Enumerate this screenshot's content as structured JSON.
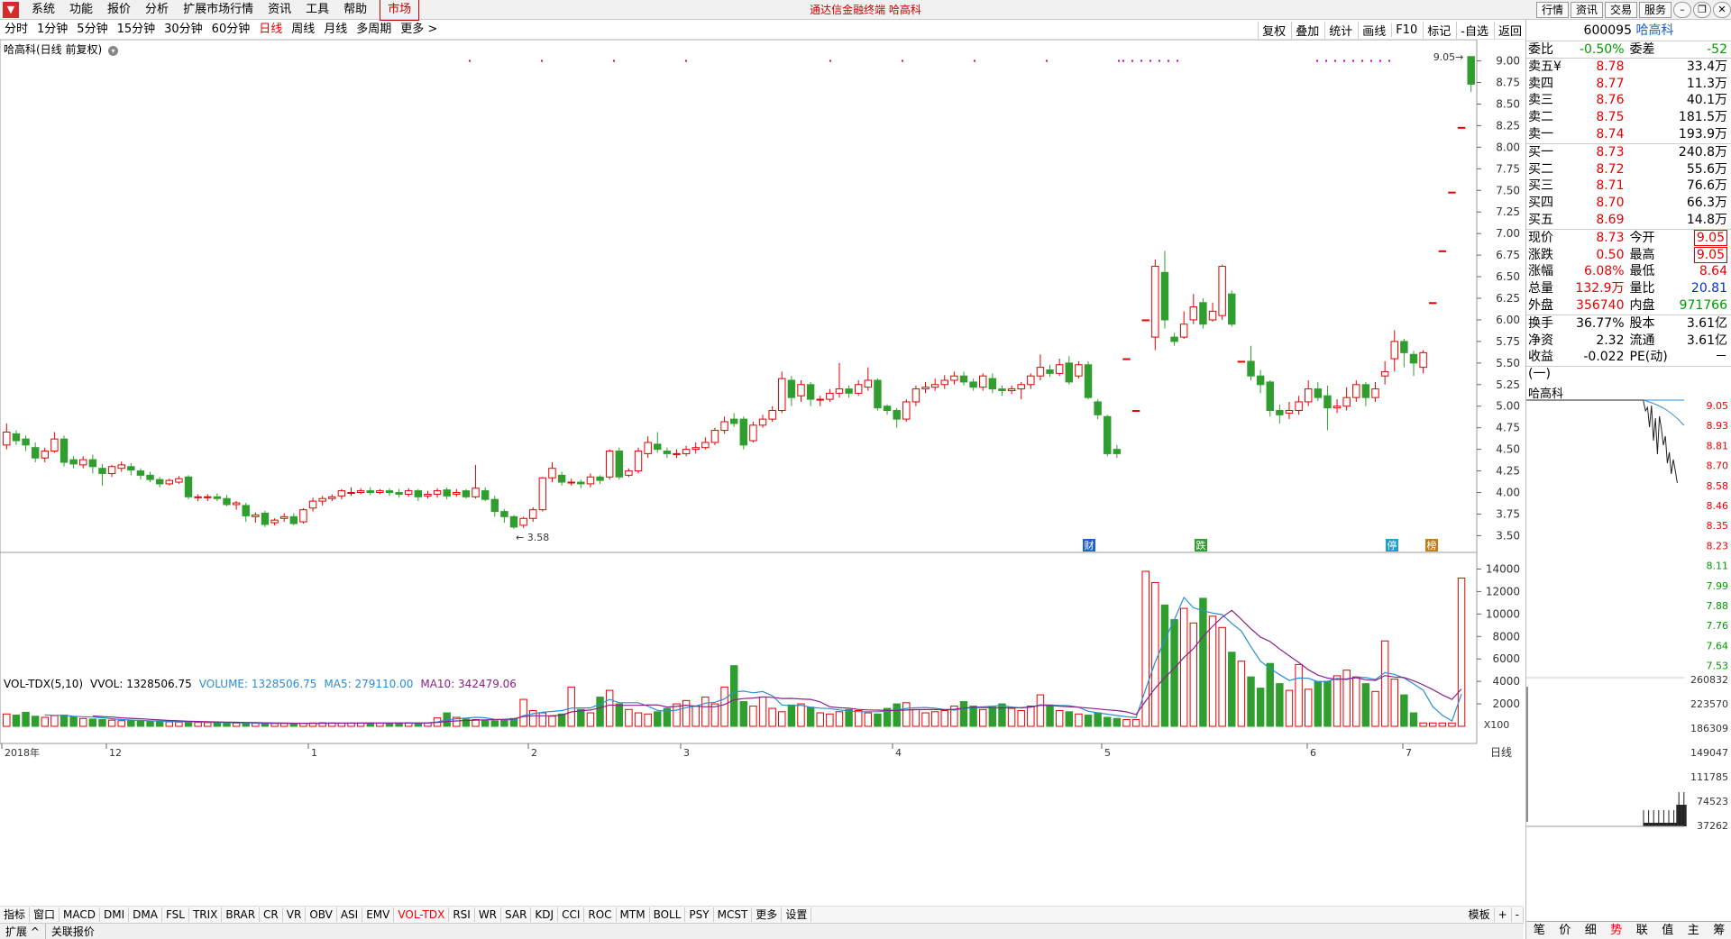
{
  "menubar": {
    "items": [
      "系统",
      "功能",
      "报价",
      "分析",
      "扩展市场行情",
      "资讯",
      "工具",
      "帮助"
    ],
    "market": "市场",
    "center_title": "通达信金融终端  哈高科",
    "right_buttons": [
      "行情",
      "资讯",
      "交易",
      "服务"
    ]
  },
  "periods": [
    "分时",
    "1分钟",
    "5分钟",
    "15分钟",
    "30分钟",
    "60分钟",
    "日线",
    "周线",
    "月线",
    "多周期",
    "更多 >"
  ],
  "active_period": "日线",
  "chart_tools": [
    "复权",
    "叠加",
    "统计",
    "画线",
    "F10",
    "标记",
    "-自选",
    "返回"
  ],
  "kline_title": "哈高科(日线 前复权)",
  "vol_header": {
    "name": "VOL-TDX(5,10)",
    "vvol": "VVOL: 1328506.75",
    "volume": "VOLUME: 1328506.75",
    "ma5": "MA5: 279110.00",
    "ma10": "MA10: 342479.06"
  },
  "annotations": {
    "low": "3.58",
    "high": "9.05",
    "x100": "X100",
    "markers": [
      "财",
      "跌",
      "停",
      "榜"
    ]
  },
  "price_axis": [
    "9.00",
    "8.75",
    "8.50",
    "8.25",
    "8.00",
    "7.75",
    "7.50",
    "7.25",
    "7.00",
    "6.75",
    "6.50",
    "6.25",
    "6.00",
    "5.75",
    "5.50",
    "5.25",
    "5.00",
    "4.75",
    "4.50",
    "4.25",
    "4.00",
    "3.75",
    "3.50"
  ],
  "vol_axis": [
    "14000",
    "12000",
    "10000",
    "8000",
    "6000",
    "4000",
    "2000"
  ],
  "time_axis": [
    "2018年",
    "12",
    "1",
    "2",
    "3",
    "4",
    "5",
    "6",
    "7"
  ],
  "indicator_tabs": [
    "指标",
    "窗口",
    "MACD",
    "DMI",
    "DMA",
    "FSL",
    "TRIX",
    "BRAR",
    "CR",
    "VR",
    "OBV",
    "ASI",
    "EMV",
    "VOL-TDX",
    "RSI",
    "WR",
    "SAR",
    "KDJ",
    "CCI",
    "ROC",
    "MTM",
    "BOLL",
    "PSY",
    "MCST",
    "更多",
    "设置"
  ],
  "active_indicator": "VOL-TDX",
  "template_btn": "模板",
  "dayline_btn": "日线",
  "bottom_strip": [
    "扩展 ^",
    "关联报价"
  ],
  "quote": {
    "code": "600095",
    "name": "哈高科",
    "weibi_label": "委比",
    "weibi": "-0.50%",
    "weicha_label": "委差",
    "weicha": "-52",
    "asks": [
      {
        "label": "卖五",
        "price": "8.78",
        "vol": "33.4万"
      },
      {
        "label": "卖四",
        "price": "8.77",
        "vol": "11.3万"
      },
      {
        "label": "卖三",
        "price": "8.76",
        "vol": "40.1万"
      },
      {
        "label": "卖二",
        "price": "8.75",
        "vol": "181.5万"
      },
      {
        "label": "卖一",
        "price": "8.74",
        "vol": "193.9万"
      }
    ],
    "bids": [
      {
        "label": "买一",
        "price": "8.73",
        "vol": "240.8万"
      },
      {
        "label": "买二",
        "price": "8.72",
        "vol": "55.6万"
      },
      {
        "label": "买三",
        "price": "8.71",
        "vol": "76.6万"
      },
      {
        "label": "买四",
        "price": "8.70",
        "vol": "66.3万"
      },
      {
        "label": "买五",
        "price": "8.69",
        "vol": "14.8万"
      }
    ],
    "stats": [
      {
        "l1": "现价",
        "v1": "8.73",
        "l2": "今开",
        "v2": "9.05"
      },
      {
        "l1": "涨跌",
        "v1": "0.50",
        "l2": "最高",
        "v2": "9.05"
      },
      {
        "l1": "涨幅",
        "v1": "6.08%",
        "l2": "最低",
        "v2": "8.64"
      },
      {
        "l1": "总量",
        "v1": "132.9万",
        "l2": "量比",
        "v2": "20.81"
      },
      {
        "l1": "外盘",
        "v1": "356740",
        "l2": "内盘",
        "v2": "971766"
      }
    ],
    "fund": [
      {
        "l1": "换手",
        "v1": "36.77%",
        "l2": "股本",
        "v2": "3.61亿"
      },
      {
        "l1": "净资",
        "v1": "2.32",
        "l2": "流通",
        "v2": "3.61亿"
      },
      {
        "l1": "收益(一)",
        "v1": "-0.022",
        "l2": "PE(动)",
        "v2": "－"
      }
    ],
    "currency_mark": "¥"
  },
  "mini": {
    "title": "哈高科",
    "price_labels": [
      "9.05",
      "8.93",
      "8.81",
      "8.70",
      "8.58",
      "8.46",
      "8.35",
      "8.23",
      "8.11",
      "7.99",
      "7.88",
      "7.76",
      "7.64",
      "7.53"
    ],
    "vol_labels": [
      "260832",
      "223570",
      "186309",
      "149047",
      "111785",
      "74523",
      "37262"
    ]
  },
  "right_tabs": [
    "笔",
    "价",
    "细",
    "势",
    "联",
    "值",
    "主",
    "筹"
  ],
  "active_right_tab": "势",
  "colors": {
    "up": "#e60000",
    "down": "#2f9e2f",
    "ma5": "#2a8dd4",
    "ma10": "#8b1f8b",
    "accent": "#e60000"
  },
  "chart_data": {
    "type": "candlestick",
    "title": "哈高科(日线 前复权)",
    "ylim": [
      3.4,
      9.1
    ],
    "candles": [
      [
        4.55,
        4.7,
        4.8,
        4.5
      ],
      [
        4.68,
        4.6,
        4.72,
        4.55
      ],
      [
        4.62,
        4.55,
        4.66,
        4.48
      ],
      [
        4.52,
        4.4,
        4.58,
        4.35
      ],
      [
        4.4,
        4.48,
        4.52,
        4.35
      ],
      [
        4.48,
        4.62,
        4.7,
        4.46
      ],
      [
        4.62,
        4.35,
        4.66,
        4.3
      ],
      [
        4.38,
        4.33,
        4.42,
        4.28
      ],
      [
        4.32,
        4.38,
        4.42,
        4.28
      ],
      [
        4.38,
        4.3,
        4.44,
        4.22
      ],
      [
        4.28,
        4.22,
        4.33,
        4.08
      ],
      [
        4.22,
        4.3,
        4.32,
        4.18
      ],
      [
        4.28,
        4.32,
        4.36,
        4.24
      ],
      [
        4.3,
        4.26,
        4.34,
        4.2
      ],
      [
        4.25,
        4.2,
        4.28,
        4.15
      ],
      [
        4.2,
        4.15,
        4.24,
        4.12
      ],
      [
        4.15,
        4.1,
        4.18,
        4.06
      ],
      [
        4.1,
        4.14,
        4.16,
        4.08
      ],
      [
        4.12,
        4.16,
        4.19,
        4.1
      ],
      [
        4.18,
        3.95,
        4.2,
        3.92
      ],
      [
        3.94,
        3.95,
        3.98,
        3.9
      ],
      [
        3.95,
        3.95,
        3.98,
        3.9
      ],
      [
        3.95,
        3.93,
        3.99,
        3.9
      ],
      [
        3.93,
        3.86,
        3.97,
        3.84
      ],
      [
        3.86,
        3.88,
        3.9,
        3.8
      ],
      [
        3.85,
        3.73,
        3.88,
        3.66
      ],
      [
        3.72,
        3.74,
        3.77,
        3.65
      ],
      [
        3.76,
        3.63,
        3.79,
        3.6
      ],
      [
        3.65,
        3.68,
        3.7,
        3.62
      ],
      [
        3.7,
        3.72,
        3.76,
        3.66
      ],
      [
        3.72,
        3.64,
        3.76,
        3.62
      ],
      [
        3.66,
        3.8,
        3.82,
        3.64
      ],
      [
        3.82,
        3.9,
        3.94,
        3.78
      ],
      [
        3.9,
        3.93,
        3.96,
        3.85
      ],
      [
        3.93,
        3.95,
        3.98,
        3.9
      ],
      [
        3.96,
        4.02,
        4.04,
        3.92
      ],
      [
        4.0,
        4.0,
        4.06,
        3.96
      ],
      [
        4.0,
        4.02,
        4.05,
        3.98
      ],
      [
        4.02,
        4.0,
        4.06,
        3.97
      ],
      [
        4.0,
        4.02,
        4.04,
        3.98
      ],
      [
        4.02,
        4.0,
        4.05,
        3.96
      ],
      [
        4.0,
        3.98,
        4.04,
        3.94
      ],
      [
        3.98,
        4.02,
        4.05,
        3.95
      ],
      [
        4.02,
        3.95,
        4.04,
        3.9
      ],
      [
        3.96,
        3.98,
        4.02,
        3.93
      ],
      [
        3.98,
        4.02,
        4.05,
        3.94
      ],
      [
        4.03,
        3.96,
        4.06,
        3.92
      ],
      [
        3.98,
        4.0,
        4.04,
        3.95
      ],
      [
        4.02,
        3.95,
        4.04,
        3.93
      ],
      [
        3.95,
        4.05,
        4.32,
        3.93
      ],
      [
        4.02,
        3.92,
        4.06,
        3.9
      ],
      [
        3.92,
        3.78,
        3.96,
        3.72
      ],
      [
        3.78,
        3.72,
        3.81,
        3.65
      ],
      [
        3.72,
        3.6,
        3.74,
        3.58
      ],
      [
        3.62,
        3.7,
        3.72,
        3.59
      ],
      [
        3.7,
        3.8,
        3.83,
        3.66
      ],
      [
        3.8,
        4.17,
        4.18,
        3.78
      ],
      [
        4.17,
        4.28,
        4.35,
        4.12
      ],
      [
        4.2,
        4.12,
        4.24,
        4.08
      ],
      [
        4.12,
        4.12,
        4.16,
        4.08
      ],
      [
        4.12,
        4.1,
        4.15,
        4.05
      ],
      [
        4.1,
        4.18,
        4.22,
        4.06
      ],
      [
        4.18,
        4.14,
        4.2,
        4.1
      ],
      [
        4.18,
        4.48,
        4.5,
        4.15
      ],
      [
        4.48,
        4.18,
        4.52,
        4.15
      ],
      [
        4.2,
        4.25,
        4.28,
        4.18
      ],
      [
        4.25,
        4.48,
        4.52,
        4.22
      ],
      [
        4.45,
        4.58,
        4.65,
        4.4
      ],
      [
        4.56,
        4.5,
        4.7,
        4.46
      ],
      [
        4.48,
        4.45,
        4.52,
        4.4
      ],
      [
        4.45,
        4.45,
        4.5,
        4.4
      ],
      [
        4.45,
        4.5,
        4.54,
        4.42
      ],
      [
        4.5,
        4.52,
        4.58,
        4.45
      ],
      [
        4.52,
        4.58,
        4.64,
        4.5
      ],
      [
        4.58,
        4.72,
        4.75,
        4.55
      ],
      [
        4.72,
        4.82,
        4.88,
        4.68
      ],
      [
        4.85,
        4.8,
        4.92,
        4.76
      ],
      [
        4.85,
        4.55,
        4.88,
        4.5
      ],
      [
        4.6,
        4.78,
        4.82,
        4.58
      ],
      [
        4.78,
        4.85,
        4.9,
        4.75
      ],
      [
        4.85,
        4.95,
        5.0,
        4.82
      ],
      [
        4.95,
        5.32,
        5.4,
        4.92
      ],
      [
        5.3,
        5.1,
        5.35,
        5.0
      ],
      [
        5.12,
        5.25,
        5.3,
        5.05
      ],
      [
        5.25,
        5.08,
        5.28,
        5.0
      ],
      [
        5.08,
        5.08,
        5.12,
        5.0
      ],
      [
        5.08,
        5.15,
        5.2,
        5.05
      ],
      [
        5.15,
        5.2,
        5.5,
        5.1
      ],
      [
        5.2,
        5.15,
        5.24,
        5.1
      ],
      [
        5.15,
        5.25,
        5.3,
        5.12
      ],
      [
        5.22,
        5.3,
        5.45,
        5.18
      ],
      [
        5.3,
        4.98,
        5.32,
        4.95
      ],
      [
        5.0,
        4.95,
        5.02,
        4.9
      ],
      [
        4.95,
        4.85,
        4.98,
        4.75
      ],
      [
        4.85,
        5.05,
        5.08,
        4.82
      ],
      [
        5.05,
        5.2,
        5.24,
        5.0
      ],
      [
        5.2,
        5.22,
        5.28,
        5.15
      ],
      [
        5.22,
        5.25,
        5.32,
        5.18
      ],
      [
        5.25,
        5.3,
        5.36,
        5.2
      ],
      [
        5.3,
        5.35,
        5.4,
        5.25
      ],
      [
        5.35,
        5.28,
        5.4,
        5.24
      ],
      [
        5.28,
        5.22,
        5.32,
        5.18
      ],
      [
        5.22,
        5.35,
        5.38,
        5.18
      ],
      [
        5.32,
        5.2,
        5.38,
        5.15
      ],
      [
        5.2,
        5.18,
        5.24,
        5.12
      ],
      [
        5.18,
        5.2,
        5.24,
        5.14
      ],
      [
        5.2,
        5.25,
        5.28,
        5.08
      ],
      [
        5.25,
        5.35,
        5.38,
        5.2
      ],
      [
        5.35,
        5.45,
        5.6,
        5.3
      ],
      [
        5.42,
        5.38,
        5.48,
        5.34
      ],
      [
        5.38,
        5.48,
        5.55,
        5.35
      ],
      [
        5.5,
        5.28,
        5.58,
        5.25
      ],
      [
        5.35,
        5.48,
        5.52,
        5.32
      ],
      [
        5.48,
        5.1,
        5.52,
        5.08
      ],
      [
        5.05,
        4.9,
        5.08,
        4.85
      ],
      [
        4.88,
        4.45,
        4.9,
        4.42
      ],
      [
        4.5,
        4.45,
        4.55,
        4.4
      ],
      [
        5.55,
        5.55,
        5.55,
        5.55
      ],
      [
        4.95,
        4.95,
        4.95,
        4.95
      ],
      [
        6.0,
        6.0,
        6.0,
        6.0
      ],
      [
        5.8,
        6.62,
        6.7,
        5.65
      ],
      [
        6.55,
        6.0,
        6.8,
        5.9
      ],
      [
        5.8,
        5.75,
        5.85,
        5.7
      ],
      [
        5.8,
        5.95,
        6.1,
        5.78
      ],
      [
        6.0,
        6.15,
        6.3,
        5.95
      ],
      [
        6.2,
        5.95,
        6.25,
        5.9
      ],
      [
        6.0,
        6.1,
        6.2,
        5.98
      ],
      [
        6.05,
        6.62,
        6.64,
        6.0
      ],
      [
        6.3,
        5.95,
        6.34,
        5.92
      ],
      [
        5.52,
        5.52,
        5.52,
        5.52
      ],
      [
        5.52,
        5.35,
        5.7,
        5.3
      ],
      [
        5.35,
        5.25,
        5.42,
        5.15
      ],
      [
        5.28,
        4.95,
        5.3,
        4.88
      ],
      [
        4.95,
        4.9,
        5.02,
        4.8
      ],
      [
        4.92,
        4.95,
        5.05,
        4.85
      ],
      [
        4.95,
        5.05,
        5.12,
        4.9
      ],
      [
        5.05,
        5.2,
        5.3,
        5.0
      ],
      [
        5.2,
        5.1,
        5.28,
        5.06
      ],
      [
        5.12,
        4.98,
        5.24,
        4.72
      ],
      [
        4.98,
        5.0,
        5.08,
        4.92
      ],
      [
        5.0,
        5.1,
        5.22,
        4.95
      ],
      [
        5.1,
        5.25,
        5.3,
        5.05
      ],
      [
        5.25,
        5.1,
        5.28,
        5.0
      ],
      [
        5.1,
        5.2,
        5.28,
        5.05
      ],
      [
        5.35,
        5.4,
        5.52,
        5.25
      ],
      [
        5.55,
        5.75,
        5.88,
        5.4
      ],
      [
        5.75,
        5.62,
        5.78,
        5.45
      ],
      [
        5.6,
        5.5,
        5.64,
        5.35
      ],
      [
        5.45,
        5.62,
        5.65,
        5.38
      ],
      [
        6.2,
        6.2,
        6.2,
        6.2
      ],
      [
        6.8,
        6.8,
        6.8,
        6.8
      ],
      [
        7.48,
        7.48,
        7.48,
        7.48
      ],
      [
        8.23,
        8.23,
        8.23,
        8.23
      ],
      [
        9.05,
        8.73,
        9.05,
        8.64
      ]
    ],
    "volumes": [
      1100,
      1000,
      1250,
      900,
      800,
      950,
      1000,
      850,
      700,
      650,
      600,
      550,
      500,
      500,
      450,
      450,
      420,
      400,
      380,
      360,
      350,
      330,
      320,
      300,
      290,
      280,
      270,
      260,
      250,
      250,
      260,
      280,
      300,
      320,
      300,
      280,
      290,
      300,
      300,
      280,
      290,
      300,
      320,
      310,
      300,
      750,
      1200,
      800,
      650,
      600,
      550,
      500,
      600,
      700,
      2400,
      1400,
      1200,
      900,
      1100,
      3500,
      1500,
      1200,
      2600,
      3200,
      2000,
      1500,
      1200,
      1100,
      1300,
      1600,
      2000,
      2300,
      1800,
      2600,
      2000,
      3500,
      5400,
      2200,
      1800,
      2600,
      1600,
      1300,
      1900,
      2000,
      1700,
      1200,
      1100,
      1300,
      1500,
      1400,
      1200,
      1100,
      1600,
      2000,
      2100,
      1500,
      1200,
      1300,
      1400,
      1800,
      2200,
      1800,
      1500,
      1700,
      2000,
      1600,
      1400,
      1800,
      2800,
      1900,
      1400,
      1300,
      1100,
      1000,
      1200,
      800,
      700,
      600,
      600,
      13800,
      12800,
      10800,
      9500,
      10500,
      9200,
      11400,
      9800,
      8800,
      6600,
      5800,
      4400,
      3400,
      5600,
      3800,
      3200,
      5500,
      3300,
      4000,
      4000,
      4500,
      5000,
      4400,
      3800,
      3100,
      7600,
      4200,
      2800,
      1200,
      300,
      300,
      300,
      300,
      13200
    ],
    "x_labels": [
      "2018年",
      "12",
      "1",
      "2",
      "3",
      "4",
      "5",
      "6",
      "7"
    ]
  }
}
